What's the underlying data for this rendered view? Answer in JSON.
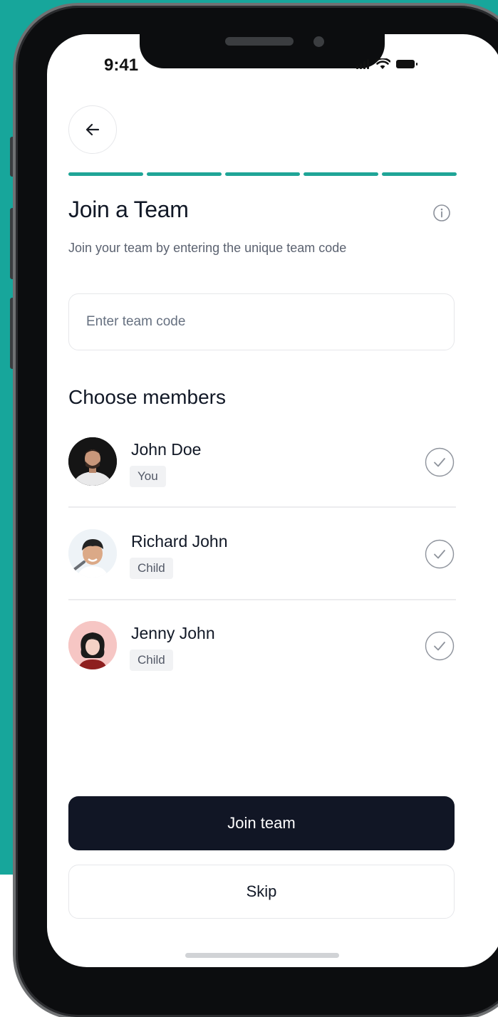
{
  "status_bar": {
    "time": "9:41"
  },
  "header": {
    "title": "Join a Team",
    "subtitle": "Join your team by entering the unique team code",
    "progress_steps": 5,
    "progress_completed": 5
  },
  "code_input": {
    "placeholder": "Enter team code",
    "value": ""
  },
  "members_section": {
    "title": "Choose members",
    "members": [
      {
        "name": "John Doe",
        "tag": "You",
        "avatar": "person-avatar-dark-bg",
        "checked": false
      },
      {
        "name": "Richard John",
        "tag": "Child",
        "avatar": "child-avatar-photo",
        "checked": false
      },
      {
        "name": "Jenny John",
        "tag": "Child",
        "avatar": "girl-avatar-pink-bg",
        "checked": false
      }
    ]
  },
  "actions": {
    "join_label": "Join team",
    "skip_label": "Skip"
  },
  "icons": {
    "back": "arrow-left-icon",
    "info": "info-icon",
    "check": "check-circle-icon"
  },
  "colors": {
    "background_teal": "#17a69b",
    "progress": "#1fa597",
    "primary_button": "#111625",
    "text_primary": "#111826",
    "text_secondary": "#5b6270"
  }
}
